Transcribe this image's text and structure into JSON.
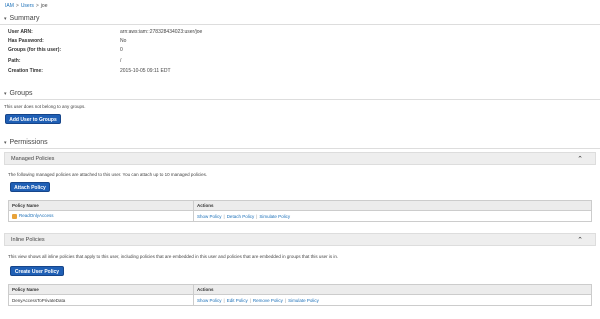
{
  "breadcrumb": {
    "items": [
      "IAM",
      "Users",
      "joe"
    ],
    "separator": ">"
  },
  "summary": {
    "heading": "Summary",
    "rows": [
      {
        "label": "User ARN:",
        "value": "arn:aws:iam::278328434023:user/joe"
      },
      {
        "label": "Has Password:",
        "value": "No"
      },
      {
        "label": "Groups (for this user):",
        "value": "0"
      },
      {
        "label": "Path:",
        "value": "/"
      },
      {
        "label": "Creation Time:",
        "value": "2015-10-05 09:11 EDT"
      }
    ]
  },
  "groups": {
    "heading": "Groups",
    "message": "This user does not belong to any groups.",
    "add_button": "Add User to Groups"
  },
  "permissions": {
    "heading": "Permissions",
    "managed": {
      "title": "Managed Policies",
      "note": "The following managed policies are attached to this user. You can attach up to 10 managed policies.",
      "button": "Attach Policy",
      "columns": [
        "Policy Name",
        "Actions"
      ],
      "rows": [
        {
          "name": "ReadOnlyAccess",
          "actions": [
            "Show Policy",
            "Detach Policy",
            "Simulate Policy"
          ]
        }
      ]
    },
    "inline": {
      "title": "Inline Policies",
      "note": "This view shows all inline policies that apply to this user, including policies that are embedded in this user and policies that are embedded in groups that this user is in.",
      "button": "Create User Policy",
      "columns": [
        "Policy Name",
        "Actions"
      ],
      "rows": [
        {
          "name": "DenyAccessToPrivateData",
          "actions": [
            "Show Policy",
            "Edit Policy",
            "Remove Policy",
            "Simulate Policy"
          ]
        }
      ]
    }
  },
  "icons": {
    "collapse": "chevron-up-icon",
    "section": "caret-down-icon",
    "policy": "managed-policy-icon"
  },
  "colors": {
    "link": "#1a6fb8",
    "button": "#1f5fb5",
    "panel_header": "#eeeeee"
  }
}
